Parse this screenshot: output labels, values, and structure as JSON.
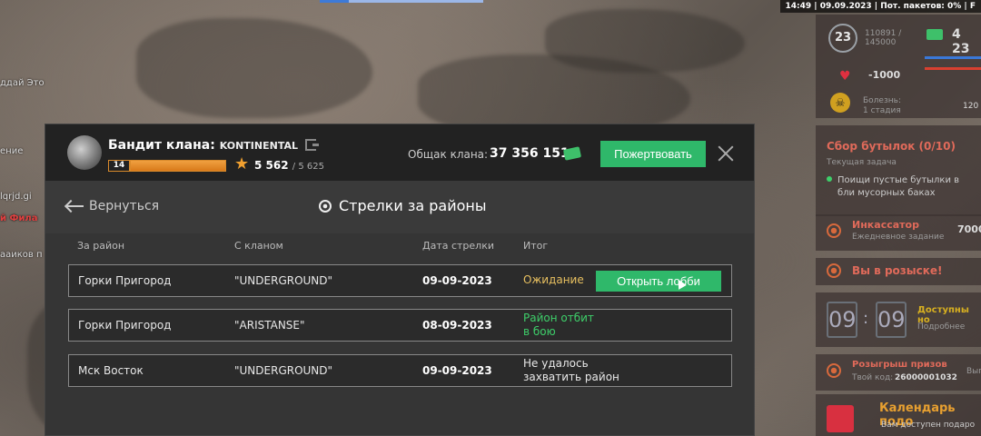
{
  "status_bar": {
    "text": "14:49 | 09.09.2023 | Пот. пакетов: 0% | F"
  },
  "chat": {
    "lines": [
      "ддай Это",
      "ение",
      "lqrjd.gi",
      "й Фила",
      "ааиков п"
    ]
  },
  "hud": {
    "level": "23",
    "xp_text": "110891 /\n145000",
    "money": "4 23",
    "health_change": "-1000",
    "disease_label": "Болезнь:",
    "disease_stage": "1 стадия",
    "disease_value": "120",
    "quest_title": "Сбор бутылок (0/10)",
    "quest_subtitle": "Текущая задача",
    "quest_desc": "Поищи пустые бутылки в бли мусорных баках",
    "collector_title": "Инкассатор",
    "collector_subtitle": "Ежедневное задание",
    "collector_value": "7000",
    "wanted_title": "Вы в розыске!",
    "timer_h": "09",
    "timer_sep": ":",
    "timer_m": "09",
    "available_title": "Доступны но",
    "available_sub": "Подробнее",
    "prizes_title": "Розыгрыш призов",
    "prizes_code_label": "Твой код:",
    "prizes_code": "26000001032",
    "prizes_extra": "Вып",
    "calendar_title": "Календарь подо",
    "calendar_sub": "Вам доступен подаро"
  },
  "panel": {
    "header": {
      "clan_label": "Бандит клана:",
      "clan_name": "KONTINENTAL",
      "level": "14",
      "xp_fraction": 1.0,
      "xp_value": "5 562",
      "xp_max": "/ 5 625",
      "treasury_label": "Общак клана:",
      "treasury_value": "37 356 151",
      "donate_label": "Пожертвовать"
    },
    "back_label": "Вернуться",
    "section_title": "Стрелки за районы",
    "columns": [
      "За район",
      "С кланом",
      "Дата стрелки",
      "Итог"
    ],
    "rows": [
      {
        "district": "Горки Пригород",
        "clan": "\"UNDERGROUND\"",
        "date": "09-09-2023",
        "status": "Ожидание",
        "status_color": "#e8c060",
        "button": "Открыть лобби"
      },
      {
        "district": "Горки Пригород",
        "clan": "\"ARISTANSE\"",
        "date": "08-09-2023",
        "status": "Район отбит\nв бою",
        "status_color": "#3ecf6a"
      },
      {
        "district": "Мск Восток",
        "clan": "\"UNDERGROUND\"",
        "date": "09-09-2023",
        "status": "Не удалось\nзахватить район",
        "status_color": "#e8e8e8"
      }
    ]
  }
}
